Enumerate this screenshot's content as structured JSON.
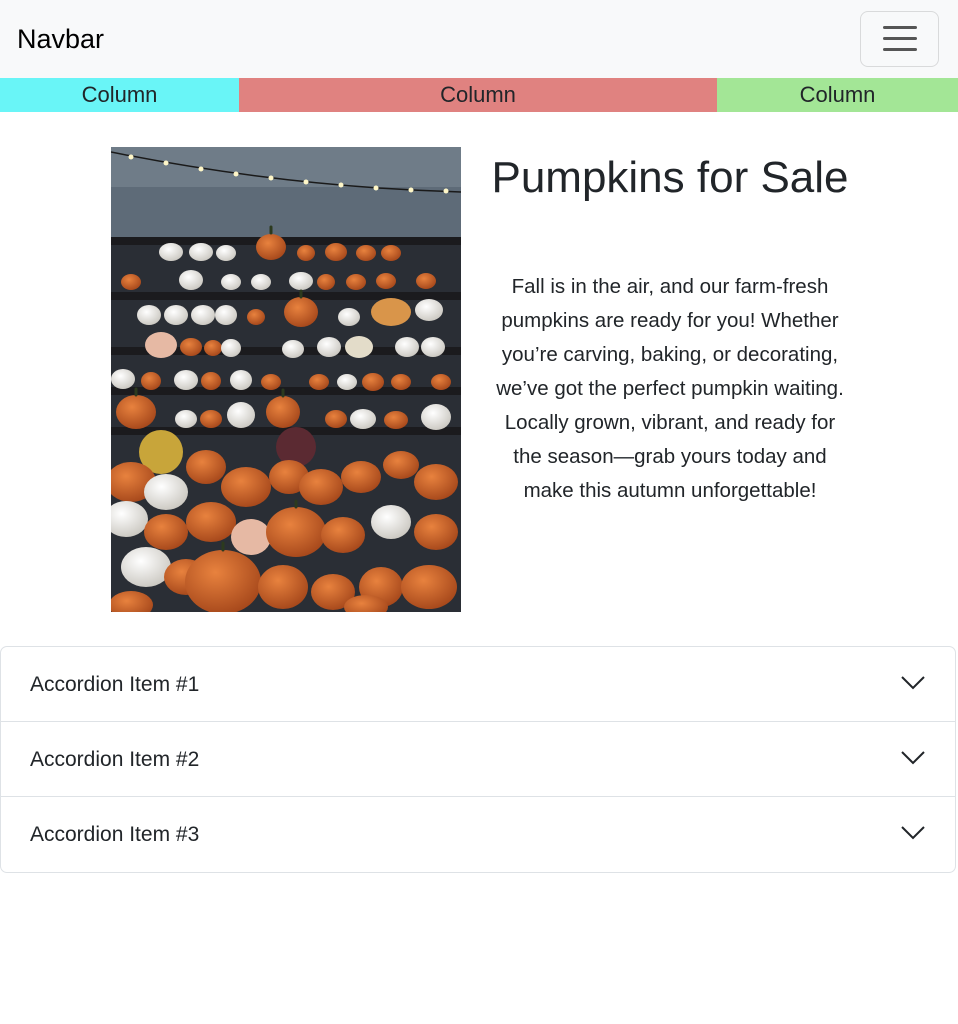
{
  "navbar": {
    "brand": "Navbar",
    "toggler_icon": "hamburger-menu-icon"
  },
  "columns": [
    {
      "label": "Column",
      "color": "#69f5f7"
    },
    {
      "label": "Column",
      "color": "#e08280"
    },
    {
      "label": "Column",
      "color": "#a3e696"
    }
  ],
  "hero": {
    "image_alt": "Rows of orange and white pumpkins on shelves",
    "title": "Pumpkins for Sale",
    "description": "Fall is in the air, and our farm-fresh pumpkins are ready for you! Whether you’re carving, baking, or decorating, we’ve got the perfect pumpkin waiting. Locally grown, vibrant, and ready for the season—grab yours today and make this autumn unforgettable!"
  },
  "accordion": {
    "items": [
      {
        "label": "Accordion Item #1",
        "icon": "chevron-down-icon"
      },
      {
        "label": "Accordion Item #2",
        "icon": "chevron-down-icon"
      },
      {
        "label": "Accordion Item #3",
        "icon": "chevron-down-icon"
      }
    ]
  }
}
